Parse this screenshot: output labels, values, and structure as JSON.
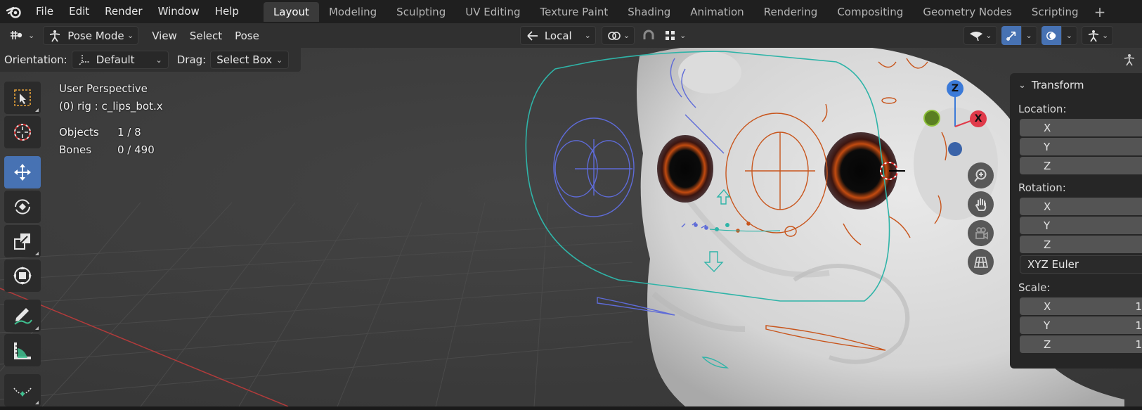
{
  "menu": {
    "items": [
      "File",
      "Edit",
      "Render",
      "Window",
      "Help"
    ]
  },
  "workspaces": {
    "active": "Layout",
    "tabs": [
      "Layout",
      "Modeling",
      "Sculpting",
      "UV Editing",
      "Texture Paint",
      "Shading",
      "Animation",
      "Rendering",
      "Compositing",
      "Geometry Nodes",
      "Scripting"
    ]
  },
  "header": {
    "mode": "Pose Mode",
    "view": "View",
    "select": "Select",
    "pose": "Pose",
    "orientation_value": "Local"
  },
  "tool_settings": {
    "orientation_label": "Orientation:",
    "orientation_value": "Default",
    "drag_label": "Drag:",
    "drag_value": "Select Box"
  },
  "overlay": {
    "view_name": "User Perspective",
    "active": "(0) rig : c_lips_bot.x",
    "objects_label": "Objects",
    "objects_value": "1 / 8",
    "bones_label": "Bones",
    "bones_value": "0 / 490"
  },
  "gizmo": {
    "z": "Z",
    "x": "X"
  },
  "transform_panel": {
    "title": "Transform",
    "location_label": "Location:",
    "rotation_label": "Rotation:",
    "scale_label": "Scale:",
    "rotation_mode": "XYZ Euler",
    "axes": [
      "X",
      "Y",
      "Z"
    ],
    "scale_values": [
      "1",
      "1",
      "1"
    ]
  },
  "colors": {
    "accent": "#4772b3",
    "bone_orange": "#c8551c",
    "bone_blue": "#5e6bd8",
    "bone_cyan": "#2fb4a8"
  }
}
